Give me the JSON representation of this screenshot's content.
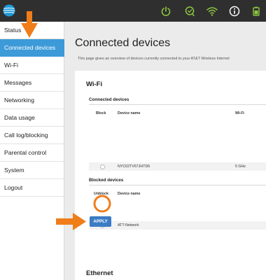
{
  "sidebar": {
    "items": [
      {
        "label": "Status",
        "active": false
      },
      {
        "label": "Connected devices",
        "active": true
      },
      {
        "label": "Wi-Fi",
        "active": false
      },
      {
        "label": "Messages",
        "active": false
      },
      {
        "label": "Networking",
        "active": false
      },
      {
        "label": "Data usage",
        "active": false
      },
      {
        "label": "Call log/blocking",
        "active": false
      },
      {
        "label": "Parental control",
        "active": false
      },
      {
        "label": "System",
        "active": false
      },
      {
        "label": "Logout",
        "active": false
      }
    ]
  },
  "topbar": {
    "icons": [
      "att-logo-icon",
      "power-icon",
      "chat-icon",
      "wifi-signal-icon",
      "info-icon",
      "battery-icon"
    ],
    "accent_green": "#8dc63f"
  },
  "main": {
    "title": "Connected devices",
    "description": "This page gives an overview of devices currently connected to your AT&T Wireless Internet"
  },
  "wifi": {
    "title": "Wi-Fi",
    "connected": {
      "title": "Connected devices",
      "columns": {
        "block": "Block",
        "device_name": "Device name",
        "wifi": "Wi-Fi"
      },
      "rows": [
        {
          "device_name": "NYC02TV67JHTD6",
          "wifi": "5 GHz"
        }
      ]
    },
    "blocked": {
      "title": "Blocked devices",
      "columns": {
        "unblock": "Unblock",
        "device_name": "Device name"
      },
      "rows": [
        {
          "device_name": "ATT-Network"
        }
      ]
    },
    "apply_label": "APPLY"
  },
  "ethernet": {
    "title": "Ethernet"
  },
  "colors": {
    "active_nav": "#3d9ad8",
    "apply_button": "#3b7cc4",
    "annotation_orange": "#ef7d1a"
  }
}
